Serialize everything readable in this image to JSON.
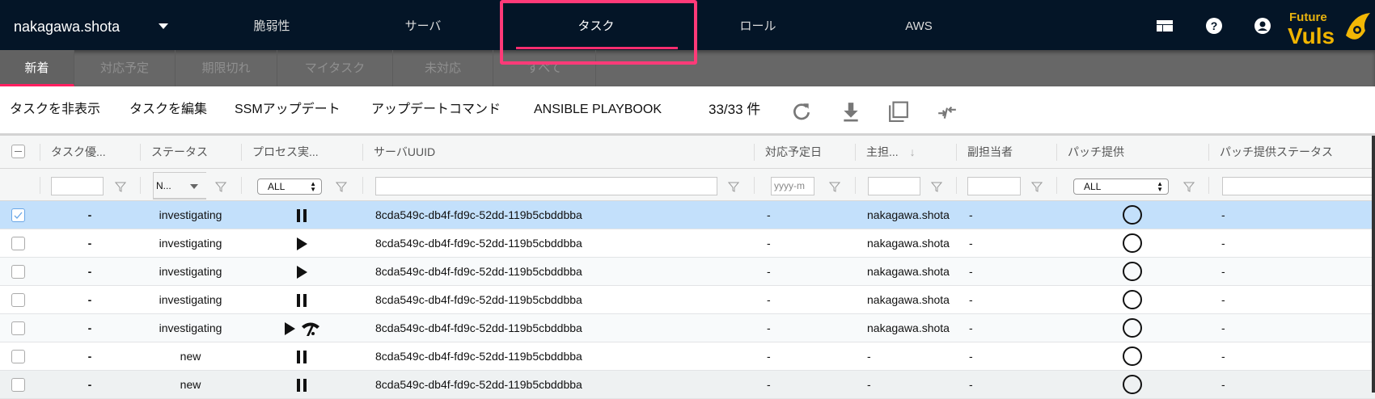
{
  "nav": {
    "user": "nakagawa.shota",
    "items": [
      {
        "label": "脆弱性"
      },
      {
        "label": "サーバ"
      },
      {
        "label": "タスク",
        "active": true
      },
      {
        "label": "ロール"
      },
      {
        "label": "AWS"
      }
    ],
    "icons": [
      "layout-icon",
      "help-icon",
      "account-icon"
    ],
    "logo": "FutureVuls",
    "accent_color": "#ff2d6f"
  },
  "subnav": {
    "tabs": [
      {
        "label": "新着",
        "active": true
      },
      {
        "label": "対応予定"
      },
      {
        "label": "期限切れ"
      },
      {
        "label": "マイタスク"
      },
      {
        "label": "未対応"
      },
      {
        "label": "すべて"
      }
    ]
  },
  "toolbar": {
    "buttons": [
      "タスクを非表示",
      "タスクを編集",
      "SSMアップデート",
      "アップデートコマンド",
      "ANSIBLE PLAYBOOK"
    ],
    "count": "33/33 件",
    "icons": [
      "refresh-icon",
      "download-icon",
      "copy-icon",
      "compress-icon"
    ]
  },
  "table": {
    "columns": [
      "タスク優...",
      "ステータス",
      "プロセス実...",
      "サーバUUID",
      "対応予定日",
      "主担...",
      "副担当者",
      "パッチ提供",
      "パッチ提供ステータス"
    ],
    "sort_indicator": "↓",
    "filters": {
      "status": "N...",
      "process": "ALL",
      "due_date_placeholder": "yyyy-m",
      "patch": "ALL"
    },
    "rows": [
      {
        "selected": true,
        "priority": "-",
        "status": "investigating",
        "process": [
          "pause"
        ],
        "uuid": "8cda549c-db4f-fd9c-52dd-119b5cbddbba",
        "due": "-",
        "main": "nakagawa.shota",
        "sub": "-",
        "patch": "○",
        "patch_status": "-"
      },
      {
        "selected": false,
        "priority": "-",
        "status": "investigating",
        "process": [
          "play"
        ],
        "uuid": "8cda549c-db4f-fd9c-52dd-119b5cbddbba",
        "due": "-",
        "main": "nakagawa.shota",
        "sub": "-",
        "patch": "○",
        "patch_status": "-"
      },
      {
        "selected": false,
        "priority": "-",
        "status": "investigating",
        "process": [
          "play"
        ],
        "uuid": "8cda549c-db4f-fd9c-52dd-119b5cbddbba",
        "due": "-",
        "main": "nakagawa.shota",
        "sub": "-",
        "patch": "○",
        "patch_status": "-"
      },
      {
        "selected": false,
        "priority": "-",
        "status": "investigating",
        "process": [
          "pause"
        ],
        "uuid": "8cda549c-db4f-fd9c-52dd-119b5cbddbba",
        "due": "-",
        "main": "nakagawa.shota",
        "sub": "-",
        "patch": "○",
        "patch_status": "-"
      },
      {
        "selected": false,
        "priority": "-",
        "status": "investigating",
        "process": [
          "play",
          "network"
        ],
        "uuid": "8cda549c-db4f-fd9c-52dd-119b5cbddbba",
        "due": "-",
        "main": "nakagawa.shota",
        "sub": "-",
        "patch": "○",
        "patch_status": "-"
      },
      {
        "selected": false,
        "priority": "-",
        "status": "new",
        "process": [
          "pause"
        ],
        "uuid": "8cda549c-db4f-fd9c-52dd-119b5cbddbba",
        "due": "-",
        "main": "-",
        "sub": "-",
        "patch": "○",
        "patch_status": "-"
      },
      {
        "selected": false,
        "priority": "-",
        "status": "new",
        "process": [
          "pause"
        ],
        "uuid": "8cda549c-db4f-fd9c-52dd-119b5cbddbba",
        "due": "-",
        "main": "-",
        "sub": "-",
        "patch": "○",
        "patch_status": "-"
      }
    ]
  }
}
